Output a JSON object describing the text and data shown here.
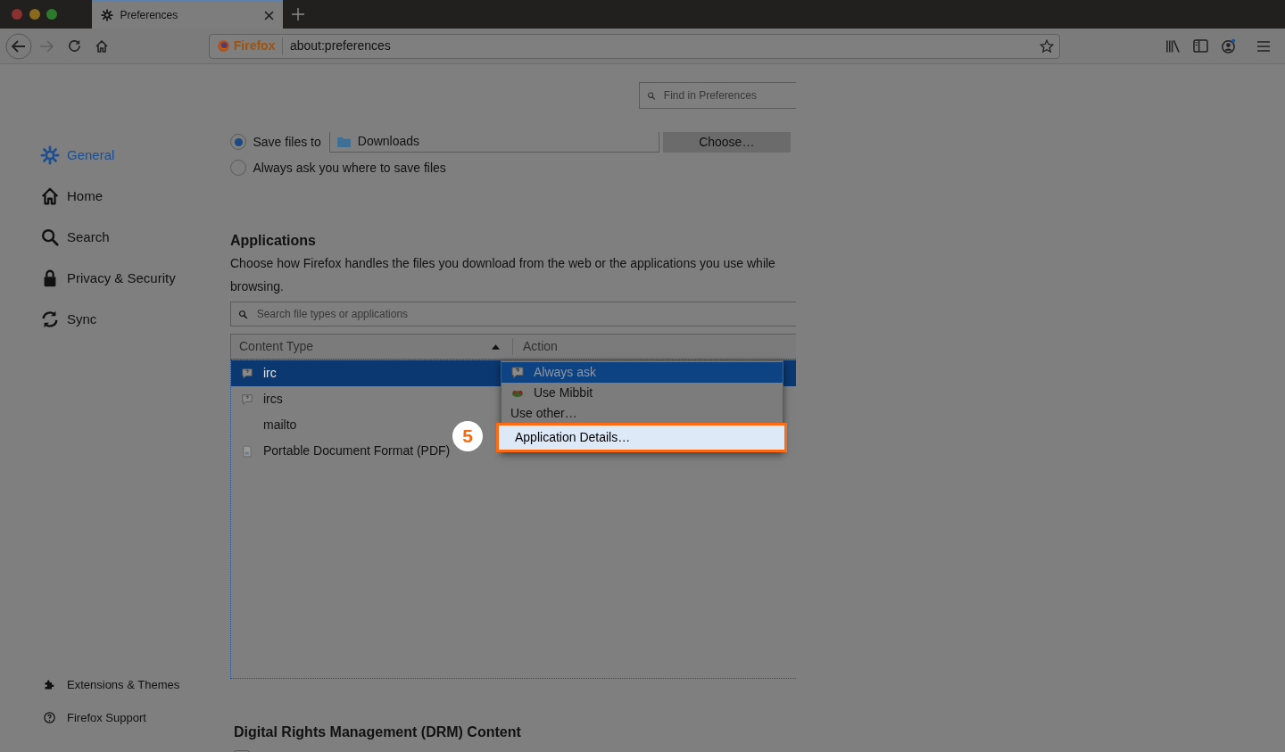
{
  "browser": {
    "tab_title": "Preferences",
    "identity": "Firefox",
    "url": "about:preferences"
  },
  "find": {
    "placeholder": "Find in Preferences"
  },
  "sidebar": {
    "items": [
      {
        "label": "General",
        "kind": "gear",
        "selected": true
      },
      {
        "label": "Home",
        "kind": "home",
        "selected": false
      },
      {
        "label": "Search",
        "kind": "search",
        "selected": false
      },
      {
        "label": "Privacy & Security",
        "kind": "lock",
        "selected": false
      },
      {
        "label": "Sync",
        "kind": "sync",
        "selected": false
      }
    ],
    "footer": [
      {
        "label": "Extensions & Themes",
        "kind": "puzzle"
      },
      {
        "label": "Firefox Support",
        "kind": "help"
      }
    ]
  },
  "downloads": {
    "options": [
      {
        "kind": "folder",
        "label": "Save files to",
        "selected": true,
        "folder": "Downloads",
        "button": "Choose…"
      },
      {
        "kind": "plain",
        "label": "Always ask you where to save files",
        "selected": false
      }
    ]
  },
  "applications": {
    "title": "Applications",
    "description": "Choose how Firefox handles the files you download from the web or the applications you use while browsing.",
    "search": {
      "placeholder": "Search file types or applications"
    },
    "columns": [
      {
        "label": "Content Type",
        "sorted": true
      },
      {
        "label": "Action",
        "sorted": false
      }
    ],
    "rows": [
      {
        "type": "irc",
        "kind": "chat",
        "selected": true
      },
      {
        "type": "ircs",
        "kind": "chat",
        "selected": false
      },
      {
        "type": "mailto",
        "kind": "plain",
        "selected": false
      },
      {
        "type": "Portable Document Format (PDF)",
        "kind": "document",
        "selected": false
      }
    ]
  },
  "action_menu": {
    "items": [
      {
        "label": "Always ask",
        "kind": "chat",
        "selected": true,
        "highlighted": false
      },
      {
        "label": "Use Mibbit",
        "kind": "app",
        "selected": false,
        "highlighted": false
      },
      {
        "label": "Use other…",
        "kind": "plain",
        "selected": false,
        "highlighted": false
      },
      {
        "label": "Application Details…",
        "kind": "plain",
        "selected": false,
        "highlighted": true
      }
    ]
  },
  "step_badge": "5",
  "drm": {
    "title": "Digital Rights Management (DRM) Content",
    "checkbox": {
      "checked": false
    }
  }
}
